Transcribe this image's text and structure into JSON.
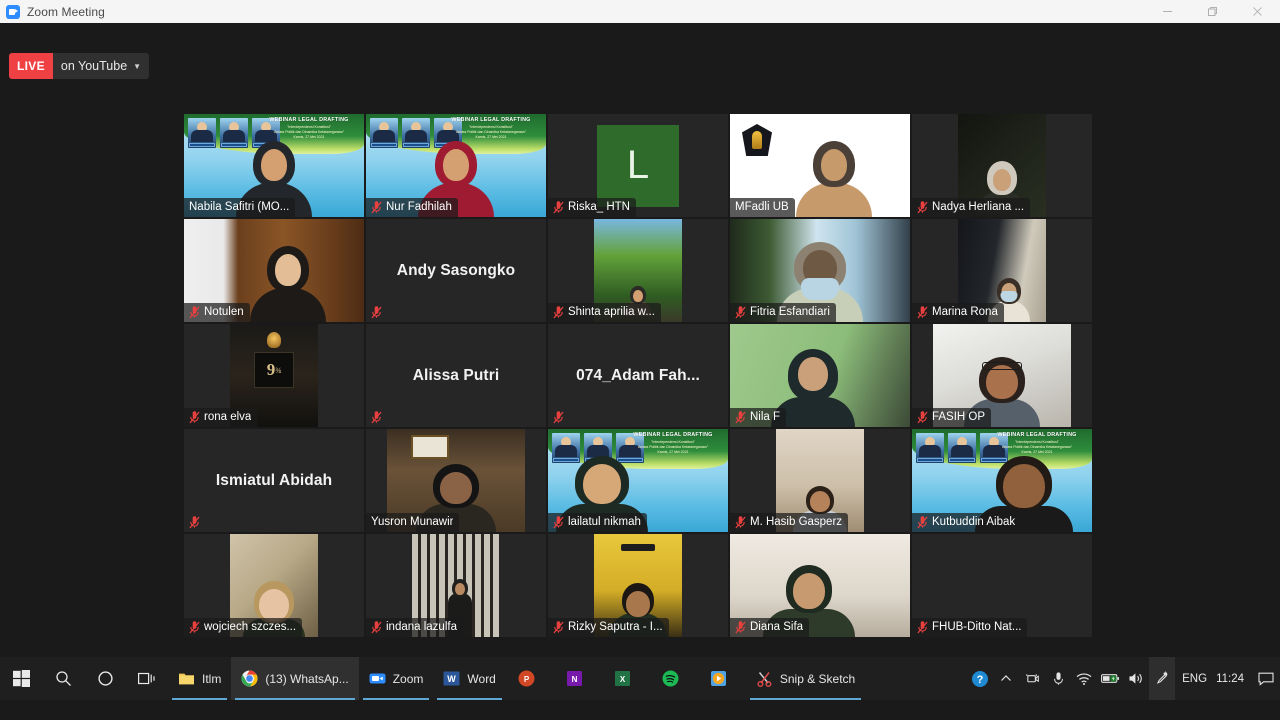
{
  "window": {
    "title": "Zoom Meeting",
    "app_icon": "zoom-icon",
    "minimize_label": "Minimize",
    "restore_label": "Restore",
    "close_label": "Close"
  },
  "stream": {
    "badge": "LIVE",
    "label": "on YouTube",
    "caret": "▼",
    "badge_color": "#ef4043"
  },
  "meeting": {
    "background_color": "#1a1a1a",
    "active_speaker_border_color": "#d9e021",
    "grid_columns": 5,
    "grid_rows": 5,
    "webinar_banner": {
      "title": "WEBINAR LEGAL DRAFTING",
      "subtitle": "\"Interdependensi Konstitusi\"",
      "subtitle2": "Antara Politik dan Dinamika Ketatanegaraan\"",
      "date": "Kamis, 27 Mei 2021"
    },
    "participants": [
      {
        "name": "Nabila Safitri (MO...",
        "muted": false,
        "active_speaker": true,
        "video": "webinar-bg",
        "label_style": "overlay"
      },
      {
        "name": "Nur Fadhilah",
        "muted": true,
        "active_speaker": false,
        "video": "webinar-bg-red",
        "label_style": "overlay"
      },
      {
        "name": "Riska_ HTN",
        "muted": true,
        "active_speaker": false,
        "video": "avatar-letter",
        "avatar_letter": "L",
        "avatar_color": "#2f6b2b",
        "label_style": "side"
      },
      {
        "name": "MFadli UB",
        "muted": false,
        "active_speaker": false,
        "video": "white-bg-logo",
        "label_style": "overlay"
      },
      {
        "name": "Nadya Herliana ...",
        "muted": true,
        "active_speaker": false,
        "video": "dark-room",
        "label_style": "side"
      },
      {
        "name": "Notulen",
        "muted": true,
        "active_speaker": false,
        "video": "wood-doors",
        "label_style": "overlay"
      },
      {
        "name": "Andy Sasongko",
        "muted": true,
        "active_speaker": false,
        "video": "none",
        "label_style": "icon-only"
      },
      {
        "name": "Shinta aprilia w...",
        "muted": true,
        "active_speaker": false,
        "video": "forest",
        "label_style": "side"
      },
      {
        "name": "Fitria Esfandiari",
        "muted": true,
        "active_speaker": false,
        "video": "window-mask",
        "label_style": "overlay"
      },
      {
        "name": "Marina Rona",
        "muted": true,
        "active_speaker": false,
        "video": "room-mask",
        "label_style": "side"
      },
      {
        "name": "rona elva",
        "muted": true,
        "active_speaker": false,
        "video": "platform-nine",
        "label_style": "side"
      },
      {
        "name": "Alissa Putri",
        "muted": true,
        "active_speaker": false,
        "video": "none",
        "label_style": "icon-only"
      },
      {
        "name": "074_Adam  Fah...",
        "muted": true,
        "active_speaker": false,
        "video": "none",
        "label_style": "icon-only"
      },
      {
        "name": "Nila F",
        "muted": true,
        "active_speaker": false,
        "video": "green-wall",
        "label_style": "overlay"
      },
      {
        "name": "FASIH OP",
        "muted": true,
        "active_speaker": false,
        "video": "bright-room",
        "label_style": "side"
      },
      {
        "name": "Ismiatul Abidah",
        "muted": true,
        "active_speaker": false,
        "video": "none",
        "label_style": "icon-only"
      },
      {
        "name": "Yusron Munawir",
        "muted": false,
        "active_speaker": false,
        "video": "office",
        "label_style": "overlay"
      },
      {
        "name": "lailatul nikmah",
        "muted": true,
        "active_speaker": false,
        "video": "webinar-bg-2",
        "label_style": "overlay"
      },
      {
        "name": "M. Hasib Gasperz",
        "muted": true,
        "active_speaker": false,
        "video": "beige-room",
        "label_style": "overlay"
      },
      {
        "name": "Kutbuddin Aibak",
        "muted": true,
        "active_speaker": false,
        "video": "webinar-bg-3",
        "label_style": "overlay"
      },
      {
        "name": "wojciech szczes...",
        "muted": true,
        "active_speaker": false,
        "video": "child-photo",
        "label_style": "side"
      },
      {
        "name": "indana lazulfa",
        "muted": true,
        "active_speaker": false,
        "video": "bars-photo",
        "label_style": "side"
      },
      {
        "name": "Rizky Saputra - I...",
        "muted": true,
        "active_speaker": false,
        "video": "yellow-wall",
        "label_style": "side"
      },
      {
        "name": "Diana Sifa",
        "muted": true,
        "active_speaker": false,
        "video": "plain-white",
        "label_style": "overlay"
      },
      {
        "name": "FHUB-Ditto Nat...",
        "muted": true,
        "active_speaker": false,
        "video": "none-dark",
        "label_style": "side"
      }
    ]
  },
  "taskbar": {
    "start": "start-button",
    "search": "search-icon",
    "cortana": "cortana-icon",
    "task_view": "task-view-icon",
    "apps": [
      {
        "label": "Itlm",
        "icon": "folder-icon",
        "state": "open",
        "color": "#f0c44a"
      },
      {
        "label": "(13) WhatsAp...",
        "icon": "chrome-icon",
        "state": "active",
        "color": "#4285f4"
      },
      {
        "label": "Zoom",
        "icon": "zoom-icon",
        "state": "open",
        "color": "#2d8cff"
      },
      {
        "label": "Word",
        "icon": "word-icon",
        "state": "open",
        "color": "#2b579a"
      },
      {
        "label": "",
        "icon": "powerpoint-icon",
        "state": "pinned",
        "color": "#d24726"
      },
      {
        "label": "",
        "icon": "onenote-icon",
        "state": "pinned",
        "color": "#7719aa"
      },
      {
        "label": "",
        "icon": "excel-icon",
        "state": "pinned",
        "color": "#217346"
      },
      {
        "label": "",
        "icon": "spotify-icon",
        "state": "pinned",
        "color": "#1db954"
      },
      {
        "label": "",
        "icon": "media-player-icon",
        "state": "pinned",
        "color": "#f5a623"
      },
      {
        "label": "Snip & Sketch",
        "icon": "snip-sketch-icon",
        "state": "open",
        "color": "#d93b3b"
      }
    ],
    "tray": {
      "help": "help-icon",
      "overflow": "chevron-up-icon",
      "camera": "camera-icon",
      "microphone": "microphone-icon",
      "network": "wifi-icon",
      "battery": "battery-charging-icon",
      "volume": "volume-icon",
      "pen": "pen-icon",
      "language": "ENG",
      "clock": "11:24",
      "notifications": "notification-icon"
    }
  }
}
